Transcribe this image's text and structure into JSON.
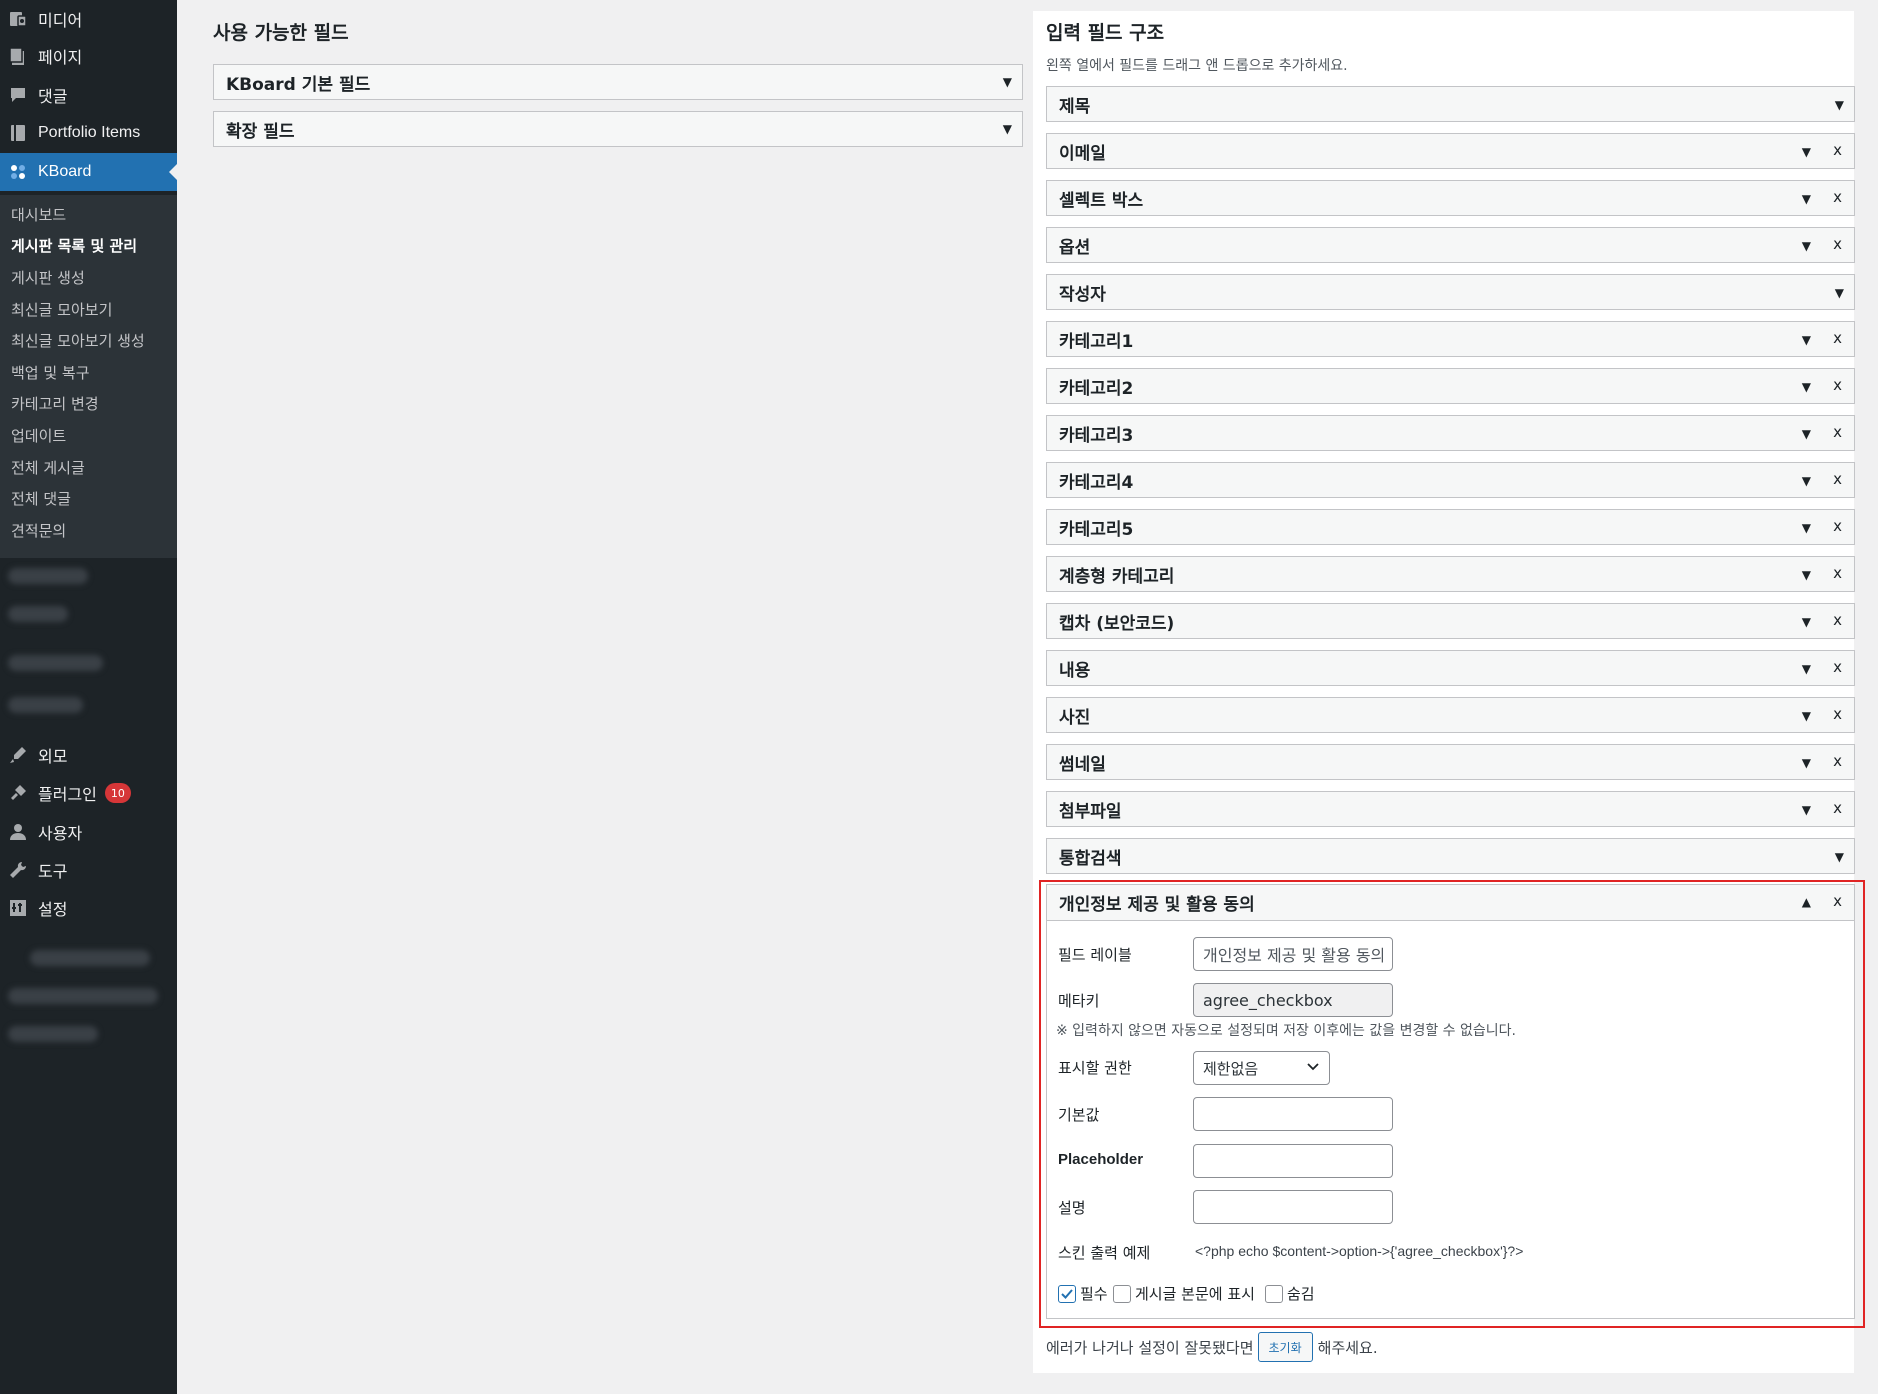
{
  "sidebar": {
    "top_items": [
      {
        "label": "미디어",
        "icon": "media-icon"
      },
      {
        "label": "페이지",
        "icon": "page-icon"
      },
      {
        "label": "댓글",
        "icon": "comment-icon"
      },
      {
        "label": "Portfolio Items",
        "icon": "portfolio-icon"
      },
      {
        "label": "KBoard",
        "icon": "kboard-icon"
      }
    ],
    "kboard_submenu": [
      "대시보드",
      "게시판 목록 및 관리",
      "게시판 생성",
      "최신글 모아보기",
      "최신글 모아보기 생성",
      "백업 및 복구",
      "카테고리 변경",
      "업데이트",
      "전체 게시글",
      "전체 댓글",
      "견적문의"
    ],
    "bottom_items": [
      {
        "label": "외모",
        "icon": "appearance-icon"
      },
      {
        "label": "플러그인",
        "icon": "plugin-icon",
        "badge": "10"
      },
      {
        "label": "사용자",
        "icon": "user-icon"
      },
      {
        "label": "도구",
        "icon": "tools-icon"
      },
      {
        "label": "설정",
        "icon": "settings-icon"
      }
    ]
  },
  "available": {
    "title": "사용 가능한 필드",
    "groups": [
      "KBoard 기본 필드",
      "확장 필드"
    ]
  },
  "structure": {
    "title": "입력 필드 구조",
    "note": "왼쪽 열에서 필드를 드래그 앤 드롭으로 추가하세요.",
    "fields": [
      {
        "label": "제목",
        "removable": false
      },
      {
        "label": "이메일",
        "removable": true
      },
      {
        "label": "셀렉트 박스",
        "removable": true
      },
      {
        "label": "옵션",
        "removable": true
      },
      {
        "label": "작성자",
        "removable": false
      },
      {
        "label": "카테고리1",
        "removable": true
      },
      {
        "label": "카테고리2",
        "removable": true
      },
      {
        "label": "카테고리3",
        "removable": true
      },
      {
        "label": "카테고리4",
        "removable": true
      },
      {
        "label": "카테고리5",
        "removable": true
      },
      {
        "label": "계층형 카테고리",
        "removable": true
      },
      {
        "label": "캡차 (보안코드)",
        "removable": true
      },
      {
        "label": "내용",
        "removable": true
      },
      {
        "label": "사진",
        "removable": true
      },
      {
        "label": "썸네일",
        "removable": true
      },
      {
        "label": "첨부파일",
        "removable": true
      },
      {
        "label": "통합검색",
        "removable": false
      }
    ],
    "arrow_down": "▼",
    "arrow_up": "▲",
    "remove_label": "x"
  },
  "expanded_field": {
    "title": "개인정보 제공 및 활용 동의",
    "label_field_label": "필드 레이블",
    "label_field_value": "개인정보 제공 및 활용 동의",
    "meta_key_label": "메타키",
    "meta_key_value": "agree_checkbox",
    "meta_key_note": "※ 입력하지 않으면 자동으로 설정되며 저장 이후에는 값을 변경할 수 없습니다.",
    "permission_label": "표시할 권한",
    "permission_value": "제한없음",
    "default_label": "기본값",
    "placeholder_label": "Placeholder",
    "description_label": "설명",
    "skin_example_label": "스킨 출력 예제",
    "skin_example_code": "<?php echo $content->option->{'agree_checkbox'}?>",
    "checkboxes": [
      {
        "label": "필수",
        "checked": true
      },
      {
        "label": "게시글 본문에 표시",
        "checked": false
      },
      {
        "label": "숨김",
        "checked": false
      }
    ]
  },
  "footer": {
    "before": "에러가 나거나 설정이 잘못됐다면",
    "reset_button": "초기화",
    "after": "해주세요."
  },
  "colors": {
    "sidebar_bg": "#1d2327",
    "active_blue": "#2271b1",
    "highlight_red": "#e02424",
    "badge_red": "#d63638"
  }
}
